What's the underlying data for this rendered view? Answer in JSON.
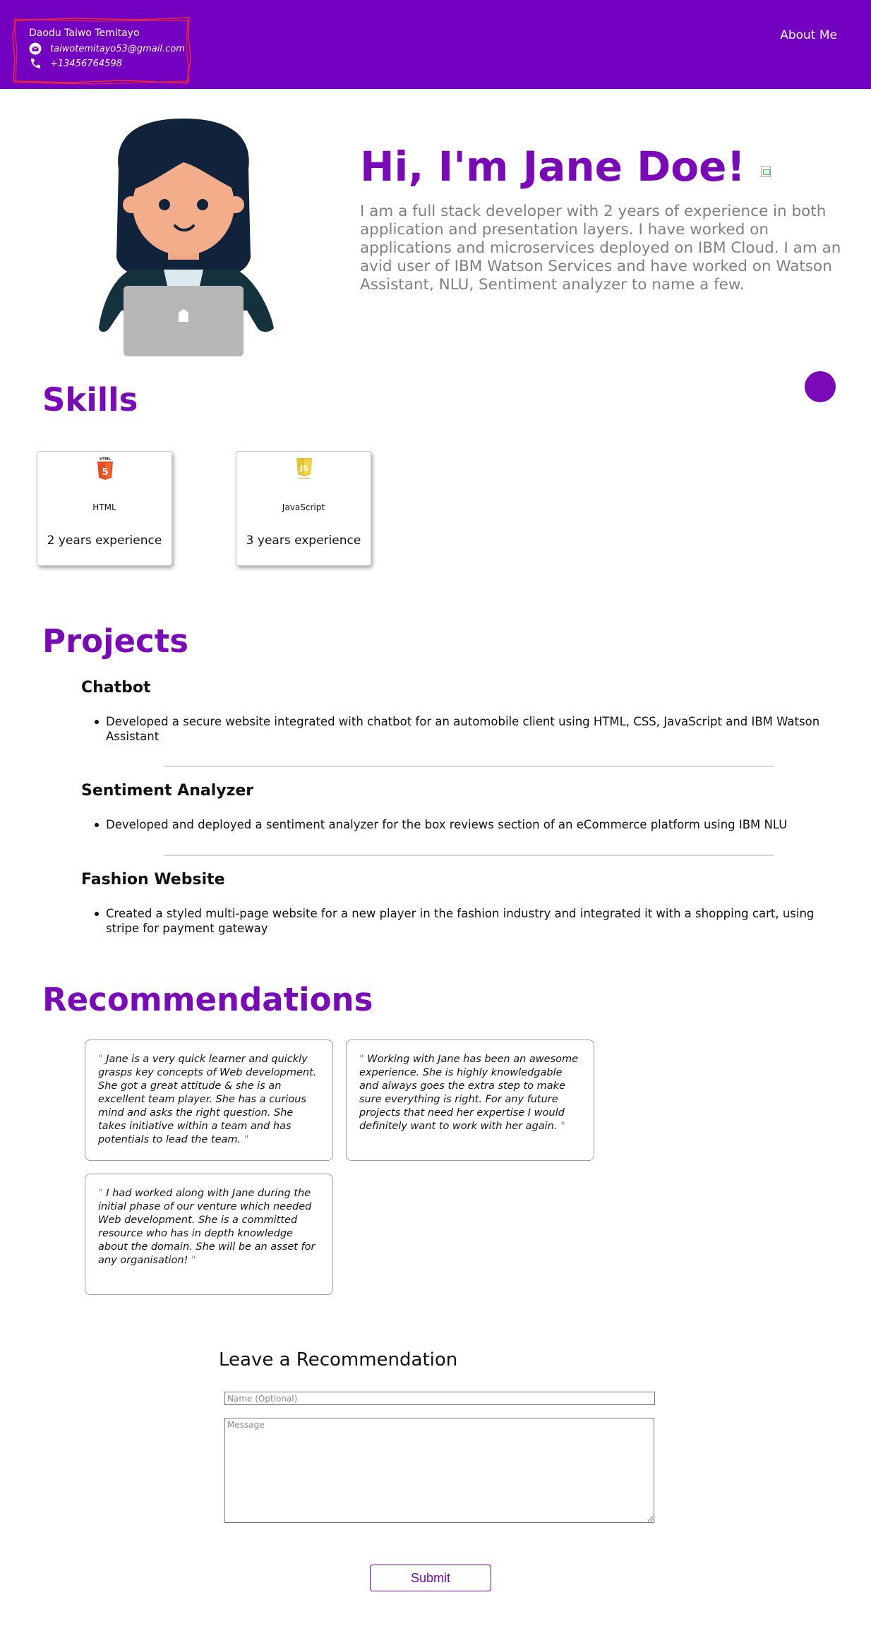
{
  "header": {
    "name": "Daodu Taiwo Temitayo",
    "email": "taiwotemitayo53@gmail.com",
    "phone": "+13456764598",
    "nav_about": "About Me",
    "colors": {
      "bar": "#7300c0",
      "scribble": "#ff2a2a"
    }
  },
  "hero": {
    "title": "Hi, I'm Jane Doe!",
    "intro": "I am a full stack developer with 2 years of experience in both application and presentation layers. I have worked on applications and microservices deployed on IBM Cloud. I am an avid user of IBM Watson Services and have worked on Watson Assistant, NLU, Sentiment analyzer to name a few."
  },
  "skills": {
    "heading": "Skills",
    "items": [
      {
        "name": "HTML",
        "experience": "2 years experience",
        "icon": "html5-icon"
      },
      {
        "name": "JavaScript",
        "experience": "3 years experience",
        "icon": "js-icon"
      }
    ]
  },
  "projects": {
    "heading": "Projects",
    "items": [
      {
        "title": "Chatbot",
        "description": "Developed a secure website integrated with chatbot for an automobile client using HTML, CSS, JavaScript and IBM Watson Assistant"
      },
      {
        "title": "Sentiment Analyzer",
        "description": "Developed and deployed a sentiment analyzer for the box reviews section of an eCommerce platform using IBM NLU"
      },
      {
        "title": "Fashion Website",
        "description": "Created a styled multi-page website for a new player in the fashion industry and integrated it with a shopping cart, using stripe for payment gateway"
      }
    ]
  },
  "recommendations": {
    "heading": "Recommendations",
    "quote_mark": "\"",
    "items": [
      {
        "text": "Jane is a very quick learner and quickly grasps key concepts of Web development. She got a great attitude & she is an excellent team player. She has a curious mind and asks the right question. She takes initiative within a team and has potentials to lead the team."
      },
      {
        "text": "Working with Jane has been an awesome experience. She is highly knowledgable and always goes the extra step to make sure everything is right. For any future projects that need her expertise I would definitely want to work with her again."
      },
      {
        "text": "I had worked along with Jane during the initial phase of our venture which needed Web development. She is a committed resource who has in depth knowledge about the domain. She will be an asset for any organisation!"
      }
    ]
  },
  "form": {
    "title": "Leave a Recommendation",
    "name_placeholder": "Name (Optional)",
    "message_placeholder": "Message",
    "submit_label": "Submit"
  },
  "accent_color": "#7a0ab8"
}
